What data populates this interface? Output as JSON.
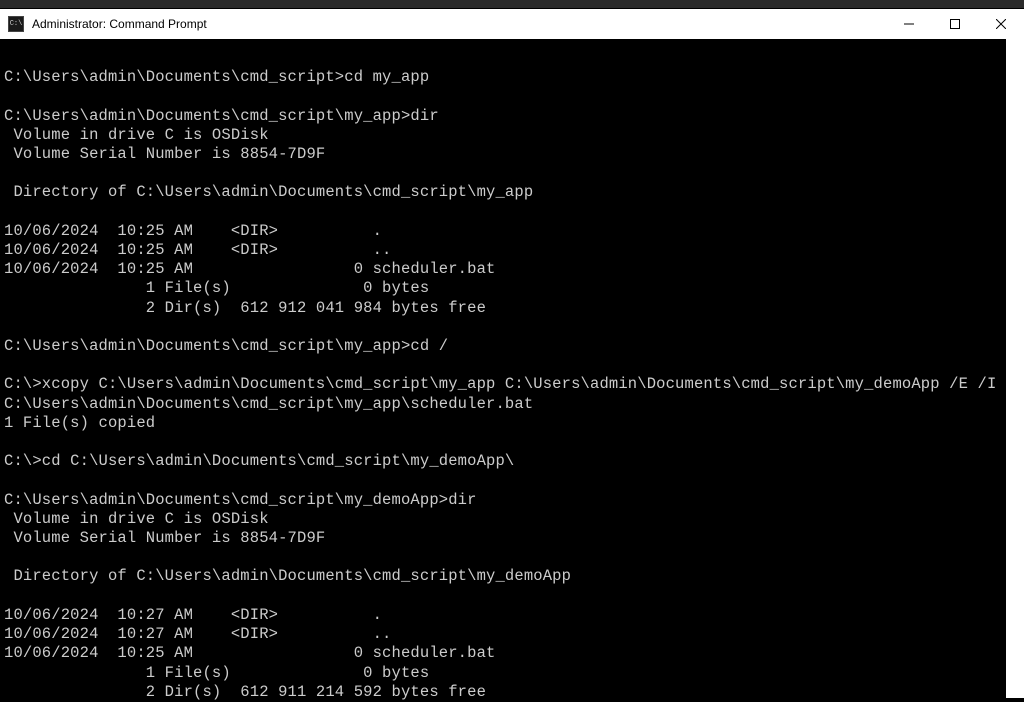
{
  "window": {
    "title": "Administrator: Command Prompt",
    "icon_label": "C:\\"
  },
  "terminal": {
    "lines": [
      "",
      "C:\\Users\\admin\\Documents\\cmd_script>cd my_app",
      "",
      "C:\\Users\\admin\\Documents\\cmd_script\\my_app>dir",
      " Volume in drive C is OSDisk",
      " Volume Serial Number is 8854-7D9F",
      "",
      " Directory of C:\\Users\\admin\\Documents\\cmd_script\\my_app",
      "",
      "10/06/2024  10:25 AM    <DIR>          .",
      "10/06/2024  10:25 AM    <DIR>          ..",
      "10/06/2024  10:25 AM                 0 scheduler.bat",
      "               1 File(s)              0 bytes",
      "               2 Dir(s)  612 912 041 984 bytes free",
      "",
      "C:\\Users\\admin\\Documents\\cmd_script\\my_app>cd /",
      "",
      "C:\\>xcopy C:\\Users\\admin\\Documents\\cmd_script\\my_app C:\\Users\\admin\\Documents\\cmd_script\\my_demoApp /E /I",
      "C:\\Users\\admin\\Documents\\cmd_script\\my_app\\scheduler.bat",
      "1 File(s) copied",
      "",
      "C:\\>cd C:\\Users\\admin\\Documents\\cmd_script\\my_demoApp\\",
      "",
      "C:\\Users\\admin\\Documents\\cmd_script\\my_demoApp>dir",
      " Volume in drive C is OSDisk",
      " Volume Serial Number is 8854-7D9F",
      "",
      " Directory of C:\\Users\\admin\\Documents\\cmd_script\\my_demoApp",
      "",
      "10/06/2024  10:27 AM    <DIR>          .",
      "10/06/2024  10:27 AM    <DIR>          ..",
      "10/06/2024  10:25 AM                 0 scheduler.bat",
      "               1 File(s)              0 bytes",
      "               2 Dir(s)  612 911 214 592 bytes free"
    ]
  }
}
